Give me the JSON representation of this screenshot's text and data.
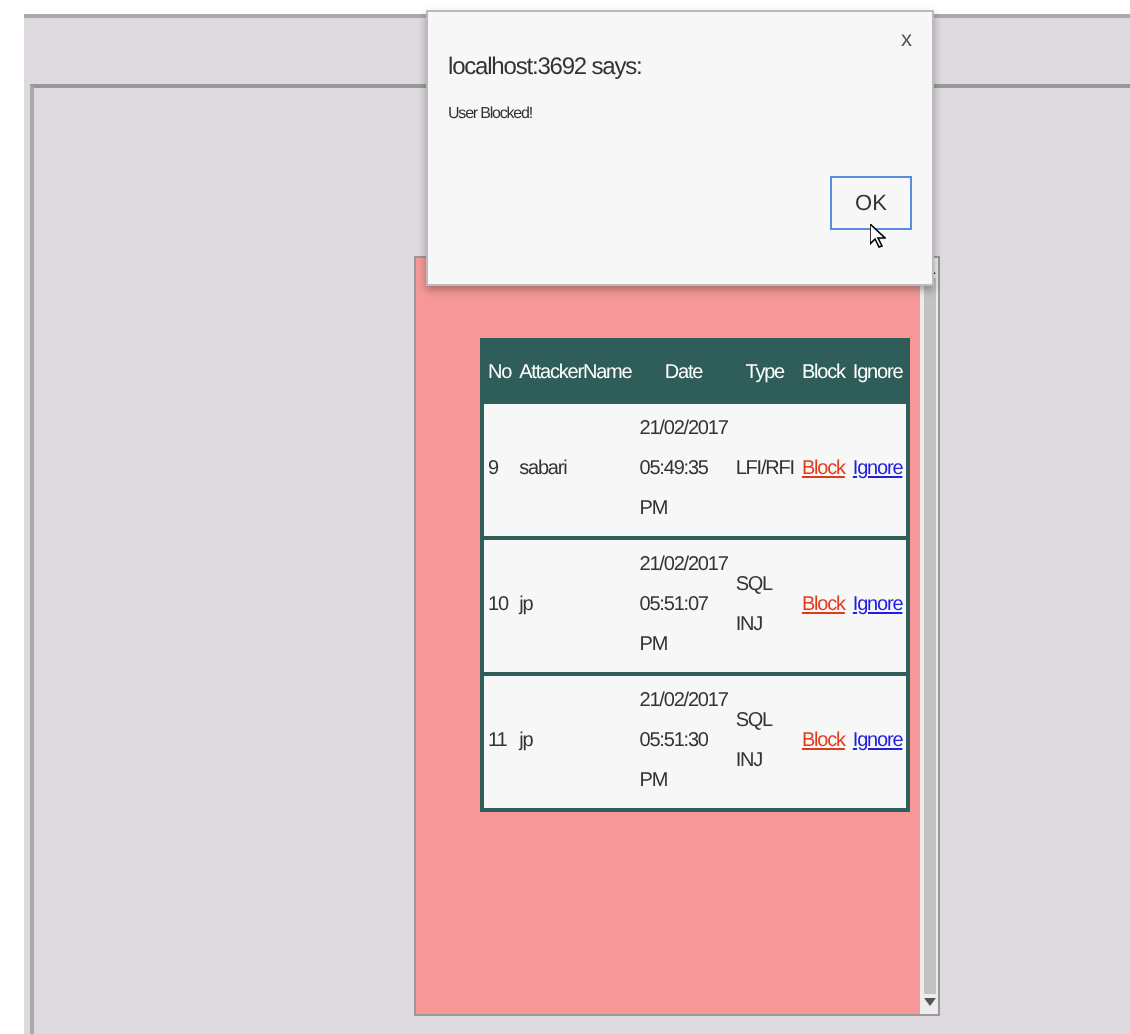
{
  "dialog": {
    "title": "localhost:3692 says:",
    "message": "User Blocked!",
    "close": "x",
    "button": "OK"
  },
  "table": {
    "columns": [
      "No",
      "AttackerName",
      "Date",
      "Type",
      "Block",
      "Ignore"
    ],
    "rows": [
      {
        "no": "9",
        "attacker": "sabari",
        "date": "21/02/2017 05:49:35 PM",
        "type": "LFI/RFI",
        "block": "Block",
        "ignore": "Ignore"
      },
      {
        "no": "10",
        "attacker": "jp",
        "date": "21/02/2017 05:51:07 PM",
        "type": "SQL INJ",
        "block": "Block",
        "ignore": "Ignore"
      },
      {
        "no": "11",
        "attacker": "jp",
        "date": "21/02/2017 05:51:30 PM",
        "type": "SQL INJ",
        "block": "Block",
        "ignore": "Ignore"
      }
    ]
  }
}
